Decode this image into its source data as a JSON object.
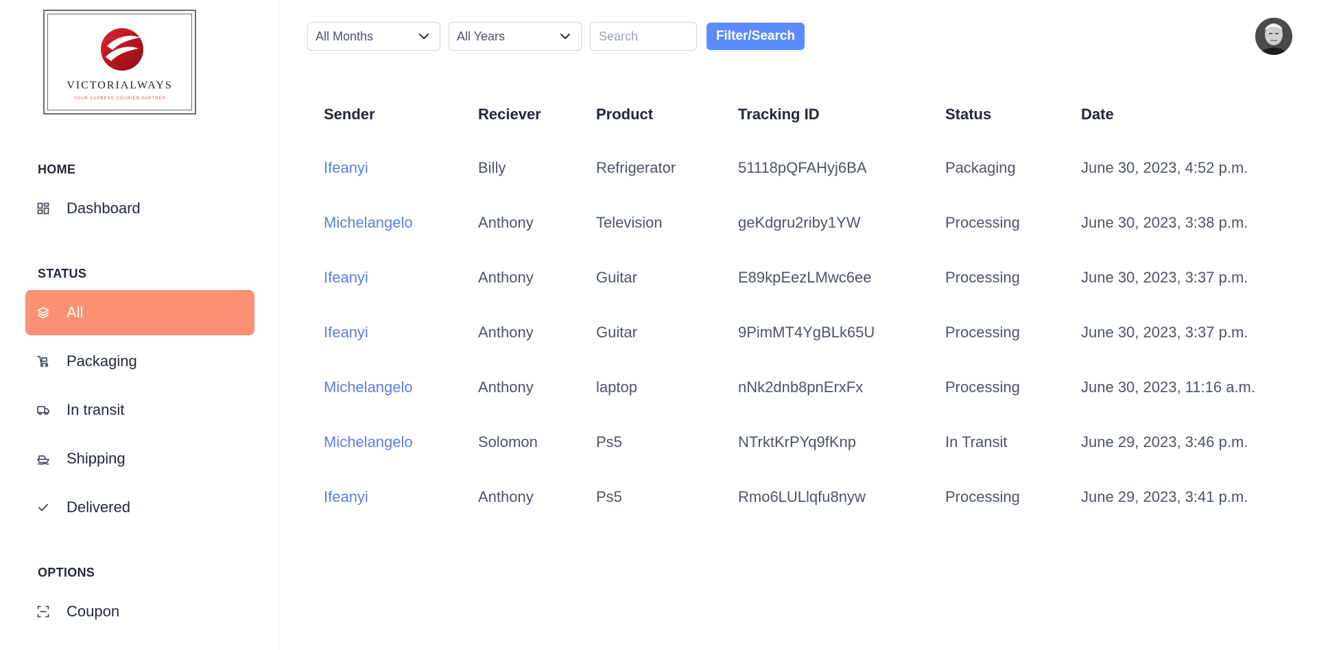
{
  "brand": {
    "name": "VICTORIALWAYS",
    "tagline": "YOUR EXPRESS COURIER PARTNER",
    "color": "#c8102e"
  },
  "sidebar": {
    "sections": [
      {
        "title": "HOME",
        "items": [
          {
            "label": "Dashboard",
            "icon": "dashboard-icon"
          }
        ]
      },
      {
        "title": "STATUS",
        "items": [
          {
            "label": "All",
            "icon": "layers-icon",
            "active": true
          },
          {
            "label": "Packaging",
            "icon": "cart-icon"
          },
          {
            "label": "In transit",
            "icon": "truck-icon"
          },
          {
            "label": "Shipping",
            "icon": "ship-icon"
          },
          {
            "label": "Delivered",
            "icon": "check-icon"
          }
        ]
      },
      {
        "title": "OPTIONS",
        "items": [
          {
            "label": "Coupon",
            "icon": "scan-icon"
          }
        ]
      }
    ],
    "active_color": "#fa9173"
  },
  "filters": {
    "month_value": "All Months",
    "year_value": "All Years",
    "search_placeholder": "Search",
    "search_value": "",
    "button_label": "Filter/Search",
    "button_color": "#5b8cff"
  },
  "table": {
    "headers": [
      "Sender",
      "Reciever",
      "Product",
      "Tracking ID",
      "Status",
      "Date"
    ],
    "rows": [
      [
        "Ifeanyi",
        "Billy",
        "Refrigerator",
        "51118pQFAHyj6BA",
        "Packaging",
        "June 30, 2023, 4:52 p.m."
      ],
      [
        "Michelangelo",
        "Anthony",
        "Television",
        "geKdgru2riby1YW",
        "Processing",
        "June 30, 2023, 3:38 p.m."
      ],
      [
        "Ifeanyi",
        "Anthony",
        "Guitar",
        "E89kpEezLMwc6ee",
        "Processing",
        "June 30, 2023, 3:37 p.m."
      ],
      [
        "Ifeanyi",
        "Anthony",
        "Guitar",
        "9PimMT4YgBLk65U",
        "Processing",
        "June 30, 2023, 3:37 p.m."
      ],
      [
        "Michelangelo",
        "Anthony",
        "laptop",
        "nNk2dnb8pnErxFx",
        "Processing",
        "June 30, 2023, 11:16 a.m."
      ],
      [
        "Michelangelo",
        "Solomon",
        "Ps5",
        "NTrktKrPYq9fKnp",
        "In Transit",
        "June 29, 2023, 3:46 p.m."
      ],
      [
        "Ifeanyi",
        "Anthony",
        "Ps5",
        "Rmo6LULlqfu8nyw",
        "Processing",
        "June 29, 2023, 3:41 p.m."
      ]
    ],
    "link_color": "#5b7fe0"
  }
}
